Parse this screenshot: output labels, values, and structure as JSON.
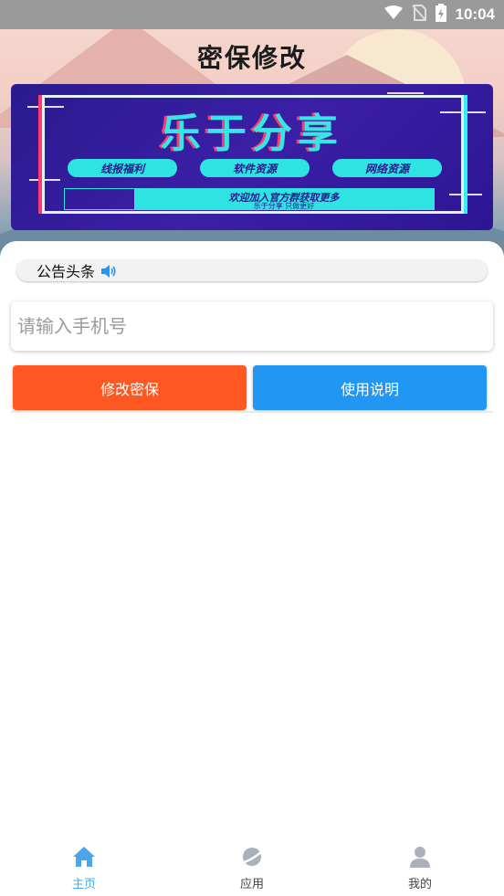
{
  "status_bar": {
    "time": "10:04",
    "icons": [
      "wifi-icon",
      "no-sim-icon",
      "battery-charging-icon"
    ]
  },
  "header": {
    "title": "密保修改"
  },
  "banner": {
    "title": "乐于分享",
    "tags": [
      "线报福利",
      "软件资源",
      "网络资源"
    ],
    "strip_main": "欢迎加入官方群获取更多",
    "strip_sub": "乐于分享 只做更好"
  },
  "notice": {
    "label": "公告头条",
    "icon": "speaker-icon"
  },
  "form": {
    "phone_placeholder": "请输入手机号",
    "phone_value": ""
  },
  "actions": {
    "modify_label": "修改密保",
    "help_label": "使用说明"
  },
  "bottom_nav": {
    "items": [
      {
        "label": "主页",
        "icon": "home-icon",
        "active": true
      },
      {
        "label": "应用",
        "icon": "planet-icon",
        "active": false
      },
      {
        "label": "我的",
        "icon": "user-icon",
        "active": false
      }
    ]
  },
  "colors": {
    "accent_orange": "#ff5722",
    "accent_blue": "#2196f3",
    "nav_active": "#4aa6e8",
    "banner_bg": "#2a1a8e",
    "banner_cyan": "#2fe3e3"
  }
}
